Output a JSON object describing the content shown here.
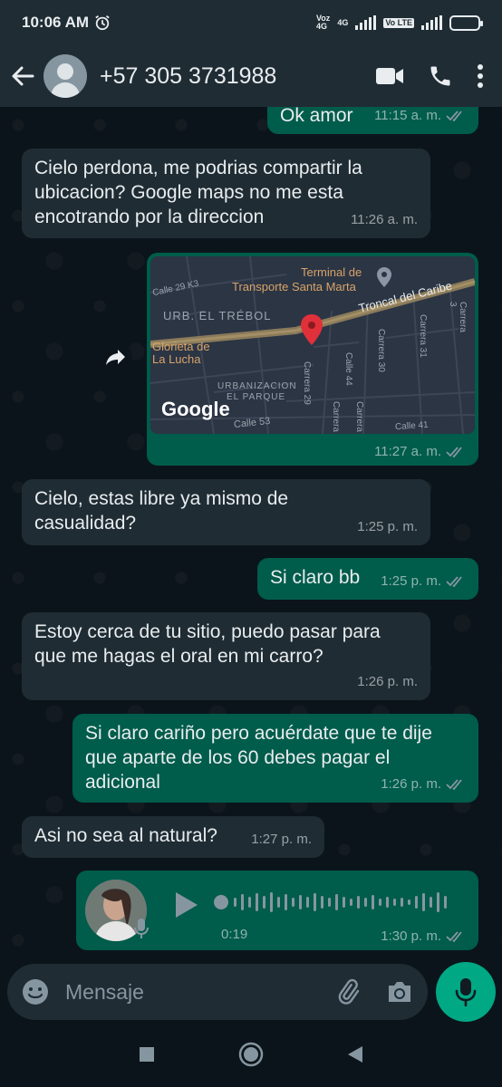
{
  "status_bar": {
    "time": "10:06 AM",
    "voz": "Voz",
    "network_4g_a": "4G",
    "network_4g_b": "4G",
    "volte": "Vo LTE"
  },
  "header": {
    "contact_name": "+57 305 3731988"
  },
  "messages": [
    {
      "type": "out",
      "text": "Ok amor",
      "time": "11:15 a. m."
    },
    {
      "type": "in",
      "text": "Cielo perdona, me podrias compartir la ubicacion? Google maps no me esta encotrando por la direccion",
      "time": "11:26 a. m."
    },
    {
      "type": "location",
      "time": "11:27 a. m."
    },
    {
      "type": "in",
      "text": "Cielo, estas libre ya mismo de casualidad?",
      "time": "1:25 p. m."
    },
    {
      "type": "out",
      "text": "Si claro bb",
      "time": "1:25 p. m."
    },
    {
      "type": "in",
      "text": "Estoy cerca de tu sitio, puedo pasar para que me hagas el oral en mi carro?",
      "time": "1:26 p. m."
    },
    {
      "type": "out",
      "text": "Si claro cariño pero acuérdate que te dije que aparte de los 60 debes pagar el adicional",
      "time": "1:26 p. m."
    },
    {
      "type": "in",
      "text": "Asi no sea al natural?",
      "time": "1:27 p. m."
    },
    {
      "type": "voice",
      "duration": "0:19",
      "time": "1:30 p. m."
    }
  ],
  "map": {
    "labels": {
      "terminal": "Terminal de",
      "terminal2": "Transporte Santa Marta",
      "troncal": "Troncal del Caribe",
      "urb_trebol": "URB. EL TRÉBOL",
      "glorieta1": "Glorieta de",
      "glorieta2": "La Lucha",
      "urbanizacion1": "URBANIZACION",
      "urbanizacion2": "EL PARQUE",
      "calle29k3": "Calle 29 K3",
      "calle53": "Calle 53",
      "calle41": "Calle 41",
      "carrera29": "Carrera 29",
      "carrera30": "Carrera 30",
      "calle44": "Calle 44",
      "carrera31": "Carrera 31",
      "carrera_a": "Carrera",
      "carrera_b": "Carrera",
      "carrera_c": "Carrera 3",
      "google": "Google"
    }
  },
  "input": {
    "placeholder": "Mensaje"
  },
  "colors": {
    "incoming": "#1f2c34",
    "outgoing": "#005c4b",
    "accent": "#00a884",
    "read_tick": "#53bdeb"
  },
  "icons": [
    "back-arrow-icon",
    "video-call-icon",
    "phone-icon",
    "menu-dots-icon",
    "forward-icon",
    "play-icon",
    "mic-icon",
    "emoji-icon",
    "attach-icon",
    "camera-icon",
    "read-ticks-icon"
  ]
}
